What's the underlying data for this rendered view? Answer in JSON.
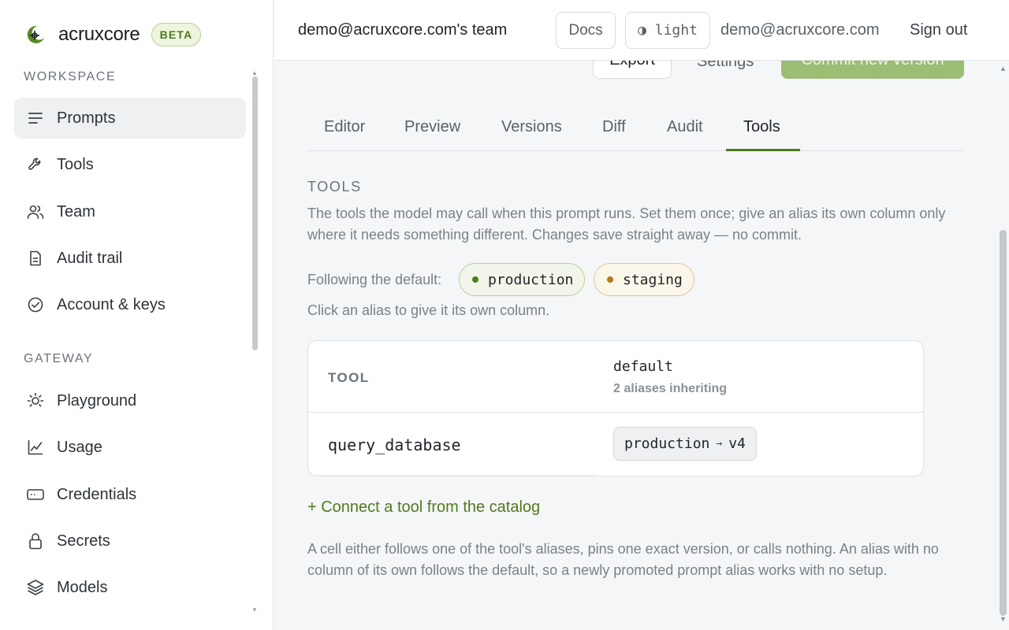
{
  "brand": {
    "name": "acruxcore",
    "badge": "BETA",
    "accent": "#4f7a1e"
  },
  "sidebar": {
    "sections": [
      {
        "label": "WORKSPACE",
        "items": [
          {
            "label": "Prompts",
            "icon": "list-icon",
            "active": true
          },
          {
            "label": "Tools",
            "icon": "wrench-icon"
          },
          {
            "label": "Team",
            "icon": "users-icon"
          },
          {
            "label": "Audit trail",
            "icon": "document-icon"
          },
          {
            "label": "Account & keys",
            "icon": "check-circle-icon"
          }
        ]
      },
      {
        "label": "GATEWAY",
        "items": [
          {
            "label": "Playground",
            "icon": "sun-icon"
          },
          {
            "label": "Usage",
            "icon": "line-chart-icon"
          },
          {
            "label": "Credentials",
            "icon": "card-icon"
          },
          {
            "label": "Secrets",
            "icon": "lock-icon"
          },
          {
            "label": "Models",
            "icon": "layers-icon"
          }
        ]
      }
    ]
  },
  "topbar": {
    "team": "demo@acruxcore.com's team",
    "docs": "Docs",
    "theme": "◑ light",
    "email": "demo@acruxcore.com",
    "signout": "Sign out"
  },
  "actions": {
    "export": "Export",
    "settings": "Settings",
    "commit": "Commit new version"
  },
  "tabs": [
    {
      "label": "Editor"
    },
    {
      "label": "Preview"
    },
    {
      "label": "Versions"
    },
    {
      "label": "Diff"
    },
    {
      "label": "Audit"
    },
    {
      "label": "Tools",
      "active": true
    }
  ],
  "tools_panel": {
    "heading": "TOOLS",
    "description": "The tools the model may call when this prompt runs. Set them once; give an alias its own column only where it needs something different. Changes save straight away — no commit.",
    "following_label": "Following the default:",
    "aliases": [
      {
        "name": "production",
        "color": "#4f7a1e"
      },
      {
        "name": "staging",
        "color": "#b07a1f"
      }
    ],
    "hint": "Click an alias to give it its own column.",
    "table": {
      "col_tool": "TOOL",
      "col_default": "default",
      "col_default_sub": "2 aliases inheriting",
      "rows": [
        {
          "tool": "query_database",
          "alias": "production",
          "arrow": "→",
          "version": "v4"
        }
      ]
    },
    "connect": "+ Connect a tool from the catalog",
    "footnote": "A cell either follows one of the tool's aliases, pins one exact version, or calls nothing. An alias with no column of its own follows the default, so a newly promoted prompt alias works with no setup."
  }
}
